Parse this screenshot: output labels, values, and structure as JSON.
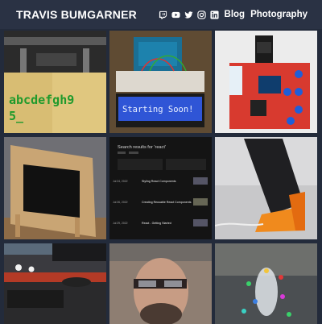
{
  "header": {
    "site_title": "TRAVIS BUMGARNER",
    "social_icons": [
      "twitch-icon",
      "youtube-icon",
      "twitter-icon",
      "instagram-icon",
      "linkedin-icon"
    ],
    "nav": [
      {
        "label": "Blog"
      },
      {
        "label": "Photography"
      }
    ]
  },
  "colors": {
    "header_bg": "#2a3244",
    "page_bg": "#232b3b",
    "text": "#ffffff"
  },
  "tiles": [
    {
      "id": "tile-1",
      "screen_text_1": "abcdefgh9",
      "screen_text_2": "5_"
    },
    {
      "id": "tile-2",
      "lcd_text": "Starting Soon!"
    },
    {
      "id": "tile-3"
    },
    {
      "id": "tile-4"
    },
    {
      "id": "tile-5",
      "search_heading": "Search results for 'react'",
      "results": [
        {
          "date": "Jul 24, 2022",
          "title": "Styling React Components"
        },
        {
          "date": "Jul 26, 2022",
          "title": "Creating Reusable React Components"
        },
        {
          "date": "Jul 29, 2022",
          "title": "React - Getting Started"
        }
      ]
    },
    {
      "id": "tile-6"
    },
    {
      "id": "tile-7"
    },
    {
      "id": "tile-8"
    },
    {
      "id": "tile-9"
    }
  ]
}
